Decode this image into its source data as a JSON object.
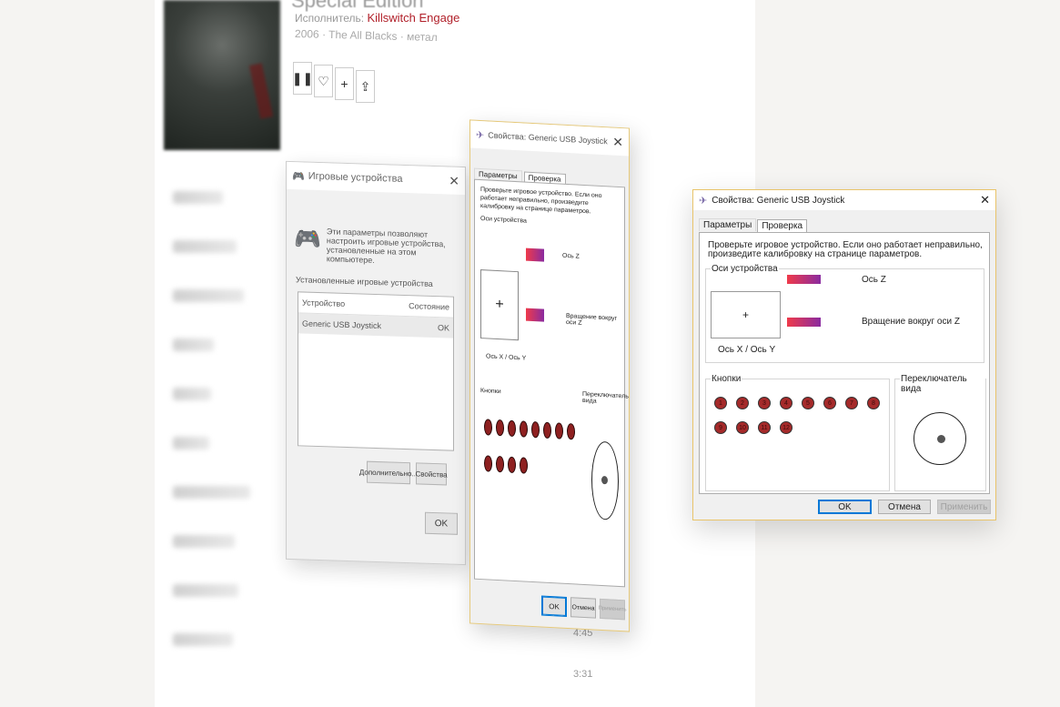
{
  "player": {
    "album_title": "Special Edition",
    "artist_prefix": "Исполнитель:",
    "artist": "Killswitch Engage",
    "meta": "2006 · The All Blacks · метал",
    "actions": [
      "pause-icon",
      "heart-icon",
      "plus-icon",
      "share-icon"
    ],
    "times": [
      "4:45",
      "3:31"
    ]
  },
  "game_controllers": {
    "title": "Игровые устройства",
    "description": "Эти параметры позволяют настроить игровые устройства, установленные на этом компьютере.",
    "group_label": "Установленные игровые устройства",
    "columns": [
      "Устройство",
      "Состояние"
    ],
    "rows": [
      {
        "device": "Generic   USB  Joystick",
        "status": "OK"
      }
    ],
    "advanced_label": "Дополнительно...",
    "properties_label": "Свойства",
    "ok_label": "OK"
  },
  "properties_mid": {
    "title": "Свойства: Generic   USB  Joystick",
    "tabs": [
      "Параметры",
      "Проверка"
    ],
    "intro": "Проверьте игровое устройство. Если оно работает неправильно, произведите калибровку на странице параметров.",
    "axes_group": "Оси устройства",
    "axis_z": "Ось Z",
    "axis_rot_z": "Вращение вокруг оси Z",
    "axis_xy": "Ось X / Ось Y",
    "buttons_group": "Кнопки",
    "pov_group": "Переключатель вида",
    "ok": "OK",
    "cancel": "Отмена",
    "apply": "Применить"
  },
  "properties": {
    "title": "Свойства: Generic   USB  Joystick",
    "tabs": {
      "params": "Параметры",
      "test": "Проверка"
    },
    "intro": "Проверьте игровое устройство. Если оно работает неправильно, произведите калибровку на странице параметров.",
    "axes_group": "Оси устройства",
    "axis_z": "Ось Z",
    "axis_rot_z": "Вращение вокруг оси Z",
    "axis_xy": "Ось X / Ось Y",
    "crosshair": "+",
    "buttons_group": "Кнопки",
    "buttons": [
      "1",
      "2",
      "3",
      "4",
      "5",
      "6",
      "7",
      "8",
      "9",
      "10",
      "11",
      "12"
    ],
    "pov_group": "Переключатель вида",
    "ok": "OK",
    "cancel": "Отмена",
    "apply": "Применить"
  },
  "colors": {
    "accent_border": "#e9c46a",
    "button_dot": "#a52a2a",
    "axis_gradient_start": "#ef3a4a",
    "axis_gradient_end": "#8a2ba0",
    "primary_button": "#0078d7",
    "artist_link": "#b1202a"
  }
}
